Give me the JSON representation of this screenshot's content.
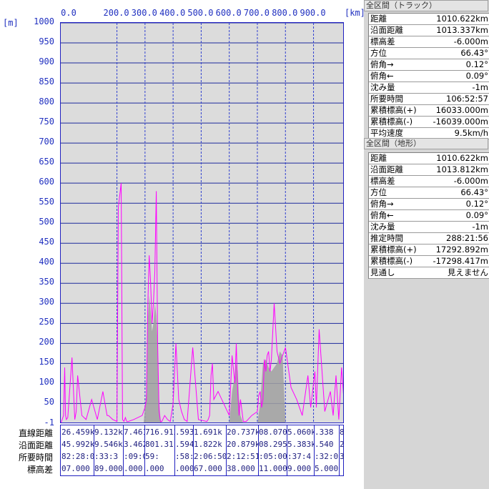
{
  "axis": {
    "y_unit": "[m]",
    "x_unit": "[km]",
    "y_ticks": [
      "1000",
      "950",
      "900",
      "850",
      "800",
      "750",
      "700",
      "650",
      "600",
      "550",
      "500",
      "450",
      "400",
      "350",
      "300",
      "250",
      "200",
      "150",
      "100",
      "50",
      "-1"
    ],
    "x_ticks": [
      {
        "label": "0.0",
        "km": 0
      },
      {
        "label": "200.0",
        "km": 200
      },
      {
        "label": "300.0",
        "km": 300
      },
      {
        "label": "400.0",
        "km": 400
      },
      {
        "label": "500.0",
        "km": 500
      },
      {
        "label": "600.0",
        "km": 600
      },
      {
        "label": "700.0",
        "km": 700
      },
      {
        "label": "800.0",
        "km": 800
      },
      {
        "label": "900.0",
        "km": 900
      }
    ]
  },
  "chart_data": {
    "type": "line",
    "xlabel": "[km]",
    "ylabel": "[m]",
    "xlim": [
      0,
      1010.622
    ],
    "ylim": [
      -1,
      1000
    ],
    "grid": true,
    "series": [
      {
        "color": "#ff00ff",
        "x": [
          0,
          10,
          14,
          17,
          20,
          25,
          40,
          50,
          55,
          60,
          75,
          90,
          110,
          130,
          150,
          165,
          170,
          185,
          200,
          205,
          215,
          220,
          225,
          230,
          235,
          240,
          260,
          290,
          300,
          305,
          310,
          315,
          320,
          325,
          330,
          335,
          340,
          345,
          350,
          355,
          360,
          370,
          380,
          390,
          400,
          410,
          420,
          430,
          440,
          450,
          470,
          490,
          520,
          525,
          530,
          535,
          540,
          545,
          560,
          600,
          610,
          620,
          625,
          630,
          635,
          640,
          650,
          660,
          680,
          700,
          705,
          710,
          715,
          720,
          725,
          730,
          735,
          740,
          745,
          750,
          760,
          770,
          780,
          800,
          820,
          840,
          860,
          880,
          890,
          900,
          905,
          910,
          920,
          940,
          960,
          970,
          980,
          990,
          1000,
          1010
        ],
        "y": [
          0,
          20,
          140,
          20,
          10,
          15,
          165,
          10,
          30,
          120,
          20,
          10,
          60,
          10,
          80,
          20,
          20,
          10,
          5,
          540,
          600,
          10,
          5,
          15,
          5,
          5,
          10,
          20,
          40,
          60,
          300,
          420,
          350,
          250,
          300,
          380,
          580,
          200,
          30,
          5,
          5,
          20,
          10,
          5,
          50,
          200,
          60,
          30,
          10,
          5,
          190,
          10,
          5,
          10,
          20,
          120,
          150,
          60,
          80,
          20,
          170,
          100,
          200,
          80,
          20,
          60,
          5,
          5,
          20,
          30,
          70,
          80,
          40,
          60,
          160,
          130,
          170,
          180,
          130,
          160,
          300,
          180,
          150,
          190,
          90,
          60,
          20,
          120,
          40,
          100,
          130,
          40,
          235,
          30,
          80,
          20,
          120,
          10,
          140,
          40
        ]
      },
      {
        "color": "#a0a0a0",
        "x": [
          295,
          300,
          305,
          310,
          315,
          320,
          325,
          330,
          335,
          340,
          345,
          350,
          355,
          360,
          600,
          610,
          620,
          625,
          630,
          635,
          640,
          650,
          700,
          710,
          720,
          730,
          740,
          750,
          760,
          770,
          780,
          790,
          800
        ],
        "y": [
          0,
          40,
          80,
          260,
          320,
          280,
          230,
          250,
          300,
          270,
          200,
          60,
          10,
          0,
          0,
          80,
          120,
          150,
          130,
          60,
          20,
          0,
          0,
          50,
          150,
          160,
          140,
          130,
          140,
          150,
          180,
          170,
          0
        ]
      }
    ]
  },
  "track_panel": {
    "title": "全区間（トラック）",
    "rows": [
      {
        "label": "距離",
        "value": "1010.622km"
      },
      {
        "label": "沿面距離",
        "value": "1013.337km"
      },
      {
        "label": "標高差",
        "value": "-6.000m"
      },
      {
        "label": "方位",
        "value": "66.43°"
      },
      {
        "label": "俯角→",
        "value": "0.12°"
      },
      {
        "label": "俯角←",
        "value": "0.09°"
      },
      {
        "label": "沈み量",
        "value": "-1m"
      },
      {
        "label": "所要時間",
        "value": "106:52:57"
      },
      {
        "label": "累積標高(+)",
        "value": "16033.000m"
      },
      {
        "label": "累積標高(-)",
        "value": "-16039.000m"
      },
      {
        "label": "平均速度",
        "value": "9.5km/h"
      }
    ]
  },
  "terrain_panel": {
    "title": "全区間（地形）",
    "rows": [
      {
        "label": "距離",
        "value": "1010.622km"
      },
      {
        "label": "沿面距離",
        "value": "1013.812km"
      },
      {
        "label": "標高差",
        "value": "-6.000m"
      },
      {
        "label": "方位",
        "value": "66.43°"
      },
      {
        "label": "俯角→",
        "value": "0.12°"
      },
      {
        "label": "俯角←",
        "value": "0.09°"
      },
      {
        "label": "沈み量",
        "value": "-1m"
      },
      {
        "label": "推定時間",
        "value": "288:21:56"
      },
      {
        "label": "累積標高(+)",
        "value": "17292.892m"
      },
      {
        "label": "累積標高(-)",
        "value": "-17298.417m"
      },
      {
        "label": "見通し",
        "value": "見えません"
      }
    ]
  },
  "segment_table": {
    "row_labels": [
      "直線距離",
      "沿面距離",
      "所要時間",
      "標高差"
    ],
    "columns": [
      [
        "26.459k",
        "45.992k",
        "82:28:0",
        "07.000"
      ],
      [
        "9.132k",
        "9.546k",
        ":33:3",
        "89.000"
      ],
      [
        "7.461",
        "3.462",
        ":09:00",
        ".000"
      ],
      [
        "716.912",
        "801.311",
        "59:",
        ".000"
      ],
      [
        ".593",
        ".594",
        ":58:7",
        ".000"
      ],
      [
        "1.691k",
        "1.822k",
        "2:06:50",
        "67.000"
      ],
      [
        "20.737k",
        "20.879k",
        "2:12:51",
        "38.000"
      ],
      [
        "08.070",
        "08.295",
        ":05:00",
        "11.000"
      ],
      [
        "5.060k",
        "5.383k",
        ":37:4",
        "9.000"
      ],
      [
        ".338",
        ".540",
        ":32:0",
        "5.000"
      ],
      [
        "8",
        "2",
        "3",
        ""
      ]
    ]
  }
}
